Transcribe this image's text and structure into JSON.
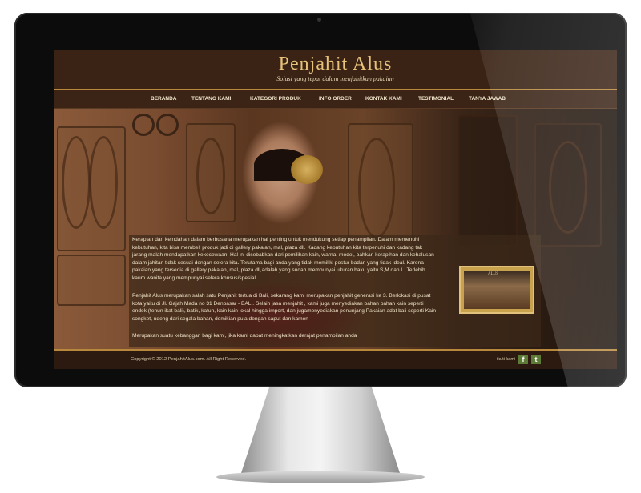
{
  "site": {
    "logo": "Penjahit Alus",
    "tagline": "Solusi yang tepat dalam menjahitkan pakaian"
  },
  "nav": {
    "items": [
      "BERANDA",
      "TENTANG KAMI",
      "KATEGORI PRODUK",
      "INFO ORDER",
      "KONTAK KAMI",
      "TESTIMONIAL",
      "TANYA JAWAB"
    ]
  },
  "content": {
    "paragraph1": "Kerapian dan keindahan dalam berbusana merupakan hal penting untuk mendukung setiap penampilan. Dalam memenuhi kebutuhan, kita bisa membeli produk jadi di gallery pakaian, mal, plaza dll. Kadang kebutuhan kita terpenuhi dan kadang tak jarang malah mendapatkan kekecewaan. Hal ini disebabkan dari pemilihan kain, warna, model, bahkan kerapihan dan kehalusan dalam jahitan tidak sesuai dengan selera kita. Terutama bagi anda yang tidak memiliki postur badan yang tidak ideal. Karena pakaian yang tersedia di gallery pakaian, mal, plaza dll,adalah yang sudah mempunyai ukuran baku yaitu S,M dan L. Terlebih kaum wanita yang mempunyai selera khusus/spesial.",
    "paragraph2": "Penjahit Alus merupakan salah satu Penjahit tertua di Bali, sekarang kami merupakan penjahit generasi ke 3. Berlokasi di pusat kota yaitu di Jl. Gajah Mada no 31 Denpasar - BALI. Selain jasa menjahit , kami juga menyediakan bahan bahan kain seperti endek (tenun ikat bali), batik, katun, kain kain lokal hingga import, dan jugamenyediakan penunjang Pakaian adat bali seperti Kain songket, udeng dari segala bahan, demikian pula dengan saput dan kamen",
    "paragraph3": "Merupakan suatu kebanggan bagi kami, jika kami dapat meningkatkan derajat penampilan anda",
    "thumbnail_sign": "ALUS"
  },
  "footer": {
    "copyright": "Copyright © 2012 PenjahitAlus.com. All Right Reserved.",
    "follow_label": "ikuti kami",
    "facebook_glyph": "f",
    "twitter_glyph": "t"
  },
  "colors": {
    "accent_gold": "#e6c27a",
    "header_brown": "#3a2315",
    "social_green": "#5d7a36"
  }
}
